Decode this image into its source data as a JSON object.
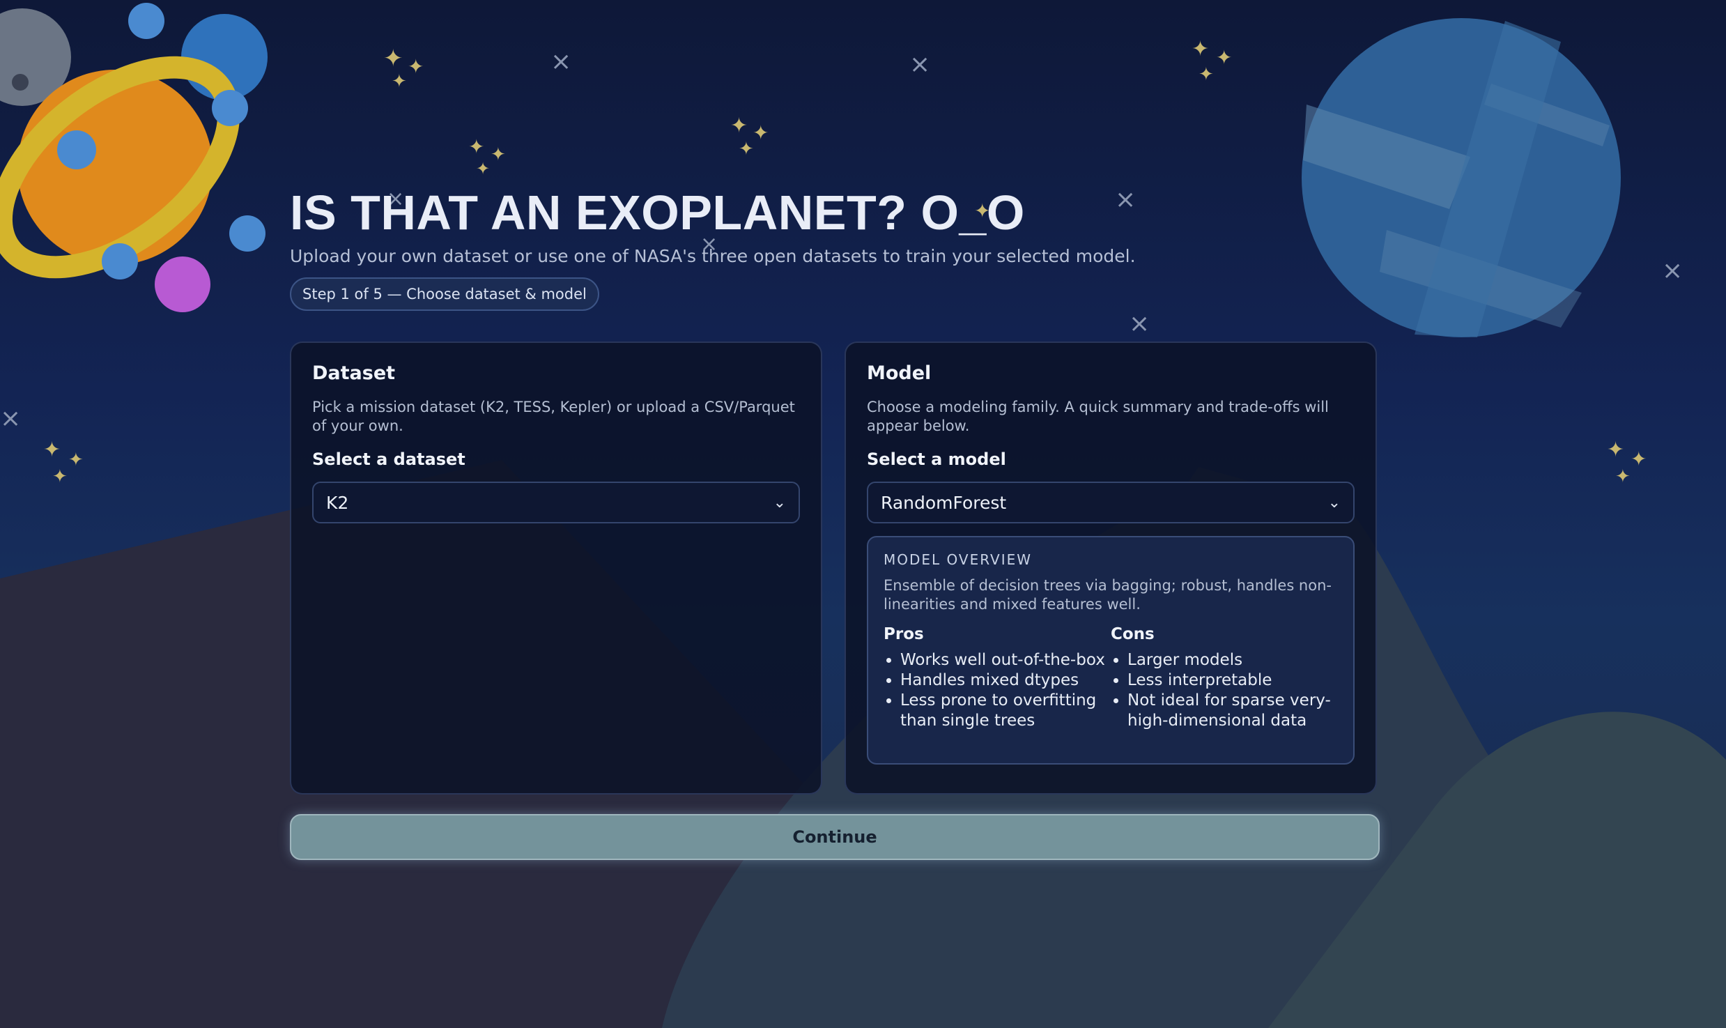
{
  "header": {
    "title": "IS THAT AN EXOPLANET? O_O",
    "subtitle": "Upload your own dataset or use one of NASA's three open datasets to train your selected model.",
    "step": "Step 1 of 5 — Choose dataset & model"
  },
  "dataset_panel": {
    "title": "Dataset",
    "description": "Pick a mission dataset (K2, TESS, Kepler) or upload a CSV/Parquet of your own.",
    "select_label": "Select a dataset",
    "selected": "K2"
  },
  "model_panel": {
    "title": "Model",
    "description": "Choose a modeling family. A quick summary and trade-offs will appear below.",
    "select_label": "Select a model",
    "selected": "RandomForest",
    "overview": {
      "heading": "MODEL OVERVIEW",
      "text": "Ensemble of decision trees via bagging; robust, handles non-linearities and mixed features well.",
      "pros_title": "Pros",
      "pros": [
        "Works well out-of-the-box",
        "Handles mixed dtypes",
        "Less prone to overfitting than single trees"
      ],
      "cons_title": "Cons",
      "cons": [
        "Larger models",
        "Less interpretable",
        "Not ideal for sparse very-high-dimensional data"
      ]
    }
  },
  "actions": {
    "continue_label": "Continue"
  },
  "icons": {
    "select_chevron": "chevron-down-icon"
  },
  "colors": {
    "background": "#132454",
    "panel": "#0b1228",
    "continue_button": "#74939b",
    "star": "#c9b870"
  }
}
